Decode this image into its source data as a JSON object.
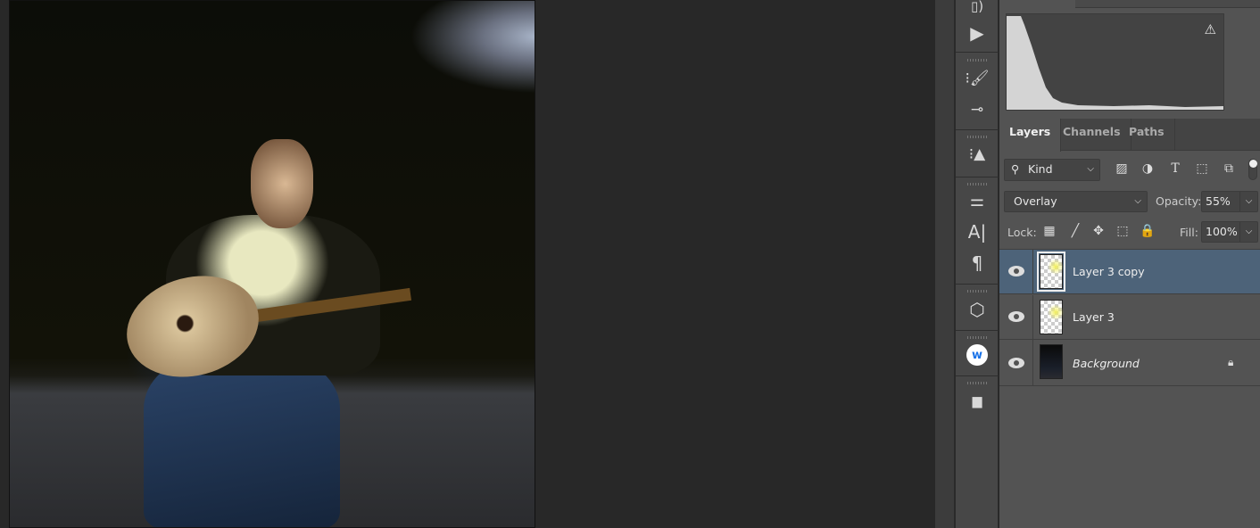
{
  "toolbar": {
    "icons": [
      "history-brush-icon",
      "play-action-icon",
      "brush-presets-icon",
      "tool-presets-icon",
      "clone-source-icon",
      "adjustments-icon",
      "character-icon",
      "paragraph-icon",
      "3d-cube-icon",
      "w-plugin-icon",
      "plugin-icon"
    ],
    "plugin_label": "w"
  },
  "histogram": {
    "warning": "⚠"
  },
  "layers_panel": {
    "tabs": [
      {
        "label": "Layers",
        "active": true
      },
      {
        "label": "Channels",
        "active": false
      },
      {
        "label": "Paths",
        "active": false
      }
    ],
    "filter": {
      "label": "Kind"
    },
    "blend_mode": "Overlay",
    "opacity_label": "Opacity:",
    "opacity": "55%",
    "lock_label": "Lock:",
    "fill_label": "Fill:",
    "fill": "100%",
    "layers": [
      {
        "name": "Layer 3 copy",
        "visible": true,
        "selected": true
      },
      {
        "name": "Layer 3",
        "visible": true,
        "selected": false
      },
      {
        "name": "Background",
        "visible": true,
        "selected": false,
        "locked": true
      }
    ]
  },
  "colors": {
    "selection": "#4d6379",
    "panel": "#535353",
    "canvas": "#282828",
    "plugin": "#1a73e8"
  }
}
